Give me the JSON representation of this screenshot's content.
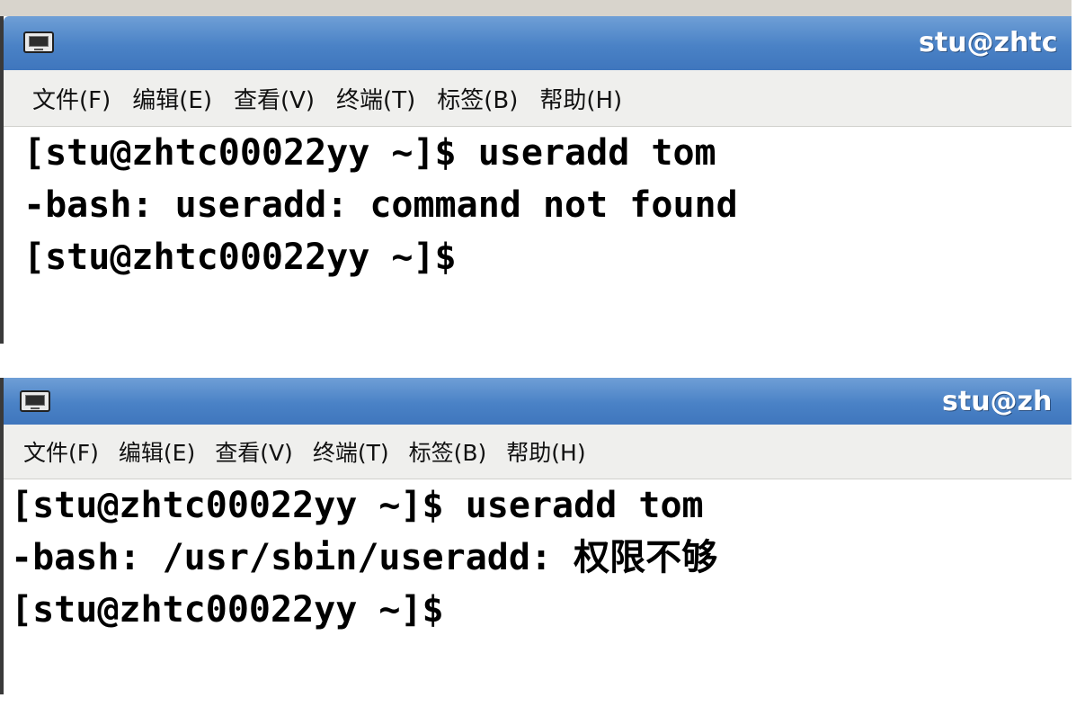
{
  "terminal1": {
    "title": "stu@zhtc",
    "menu": [
      "文件(F)",
      "编辑(E)",
      "查看(V)",
      "终端(T)",
      "标签(B)",
      "帮助(H)"
    ],
    "lines": [
      "[stu@zhtc00022yy ~]$ useradd tom",
      "-bash: useradd: command not found",
      "[stu@zhtc00022yy ~]$"
    ]
  },
  "terminal2": {
    "title": "stu@zh",
    "menu": [
      "文件(F)",
      "编辑(E)",
      "查看(V)",
      "终端(T)",
      "标签(B)",
      "帮助(H)"
    ],
    "lines": [
      "[stu@zhtc00022yy ~]$ useradd tom",
      "-bash: /usr/sbin/useradd: 权限不够",
      "[stu@zhtc00022yy ~]$"
    ]
  },
  "colors": {
    "titlebar": "#4a82c6",
    "menubar": "#efefed",
    "terminal_bg": "#ffffff",
    "terminal_fg": "#000000"
  },
  "icons": {
    "window": "terminal-window-icon"
  }
}
